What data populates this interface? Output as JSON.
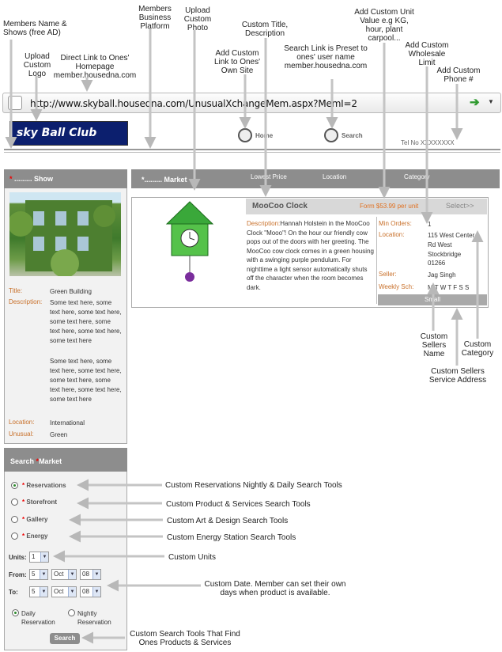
{
  "annotations": {
    "members_name": "Members Name & Shows (free AD)",
    "upload_logo": "Upload Custom Logo",
    "direct_link": "Direct Link to Ones' Homepage member.housedna.com",
    "business_platform": "Members Business Platform",
    "upload_photo": "Upload Custom Photo",
    "custom_link": "Add Custom Link to Ones' Own Site",
    "custom_title": "Custom Title, Description",
    "search_link": "Search Link is Preset to ones' user name member.housedna.com",
    "unit_value": "Add Custom Unit Value e.g KG, hour, plant carpool...",
    "wholesale": "Add Custom Wholesale Limit",
    "phone": "Add Custom Phone #",
    "sellers_name": "Custom Sellers Name",
    "category": "Custom Category",
    "service_address": "Custom Sellers Service Address",
    "reservations_tools": "Custom Reservations Nightly & Daily  Search Tools",
    "product_tools": "Custom Product & Services Search Tools",
    "art_tools": "Custom Art & Design Search Tools",
    "energy_tools": "Custom Energy Station Search Tools",
    "units": "Custom Units",
    "date_note": "Custom Date. Member can set their own days when product is available.",
    "search_tools": "Custom Search Tools That Find Ones Products & Services"
  },
  "browser": {
    "url": "http://www.skyball.housedna.com/UnusualXchangeMem.aspx?MemI=2"
  },
  "header": {
    "logo_text": "sky Ball Club",
    "home_label": "Home",
    "search_label": "Search",
    "tel": "Tel No XXXXXXXX"
  },
  "show": {
    "title": "......... Show",
    "info": {
      "title_label": "Title:",
      "title_value": "Green Building",
      "desc_label": "Description:",
      "desc_value_1": "Some text here, some text here, some text here, some text here, some text here, some text here, some text here",
      "desc_value_2": "Some text here, some text here, some text here, some text here, some text here, some text here, some text here",
      "location_label": "Location:",
      "location_value": "International",
      "unusual_label": "Unusual:",
      "unusual_value": "Green"
    }
  },
  "market": {
    "title": "*......... Market",
    "col_price": "Lowest Price",
    "col_location": "Location",
    "col_category": "Category"
  },
  "product": {
    "name": "MooCoo Clock",
    "price": "Form $53.99 per unit",
    "select": "Select>>",
    "desc_label": "Description:",
    "desc_text": "Hannah Holstein in the MooCoo Clock \"Mooo\"! On the hour our friendly cow pops out of the doors with her greeting. The MooCoo cow clock comes in a green housing with a swinging purple pendulum. For nighttime a light sensor automatically shuts off the character when the room becomes dark.",
    "min_orders_label": "Min Orders:",
    "min_orders_value": "1",
    "location_label": "Location:",
    "location_value_1": "115 West Center",
    "location_value_2": "Rd West",
    "location_value_3": "Stockbridge",
    "location_value_4": "01266",
    "seller_label": "Seller:",
    "seller_value": "Jag Singh",
    "weekly_label": "Weekly Sch:",
    "weekly_value": "M T W T F S S",
    "category": "Small"
  },
  "search": {
    "title": "Search",
    "title_suffix": "Market",
    "options": [
      "Reservations",
      "Storefront",
      "Gallery",
      "Energy"
    ],
    "units_label": "Units:",
    "units_value": "1",
    "from_label": "From:",
    "from_day": "5",
    "from_month": "Oct",
    "from_year": "08",
    "to_label": "To:",
    "to_day": "5",
    "to_month": "Oct",
    "to_year": "08",
    "daily": "Daily Reservation",
    "nightly": "Nightly Reservation",
    "button": "Search"
  }
}
